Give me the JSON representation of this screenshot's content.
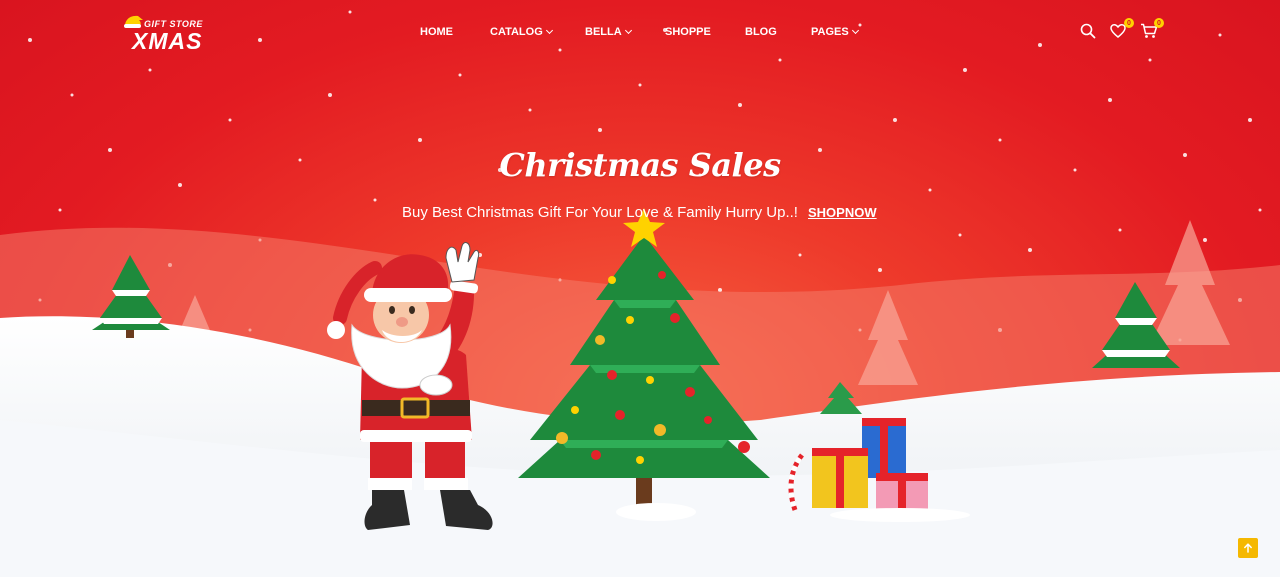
{
  "header": {
    "logo": {
      "small": "GIFT STORE",
      "big": "XMAS"
    },
    "nav": [
      {
        "label": "HOME",
        "has_dropdown": false
      },
      {
        "label": "CATALOG",
        "has_dropdown": true
      },
      {
        "label": "BELLA",
        "has_dropdown": true
      },
      {
        "label": "SHOPPE",
        "has_dropdown": false
      },
      {
        "label": "BLOG",
        "has_dropdown": false
      },
      {
        "label": "PAGES",
        "has_dropdown": true
      }
    ],
    "actions": {
      "search_icon": "search-icon",
      "wishlist_icon": "heart-icon",
      "wishlist_count": "0",
      "cart_icon": "cart-icon",
      "cart_count": "0"
    }
  },
  "banner": {
    "title": "Christmas Sales",
    "subtitle": "Buy Best Christmas Gift For Your Love & Family Hurry Up..!",
    "cta": "SHOPNOW"
  },
  "scroll_top_icon": "arrow-up-icon",
  "colors": {
    "background": "#e31b22",
    "badge": "#ffd200",
    "scroll_button": "#f5b800",
    "snow": "#ffffff"
  }
}
